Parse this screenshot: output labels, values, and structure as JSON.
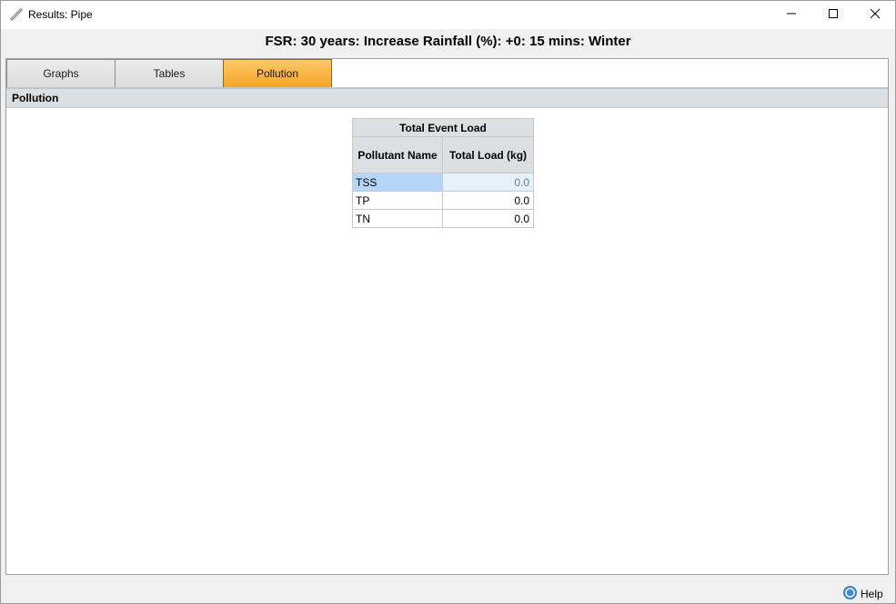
{
  "window": {
    "title": "Results: Pipe",
    "icon": "pipe-icon",
    "controls": [
      "minimize-icon",
      "maximize-icon",
      "close-icon"
    ]
  },
  "heading": "FSR: 30 years: Increase Rainfall (%): +0: 15 mins: Winter",
  "tabs": [
    {
      "label": "Graphs",
      "active": false
    },
    {
      "label": "Tables",
      "active": false
    },
    {
      "label": "Pollution",
      "active": true
    }
  ],
  "section": {
    "title": "Pollution"
  },
  "table": {
    "group_header": "Total Event Load",
    "columns": [
      "Pollutant Name",
      "Total Load (kg)"
    ],
    "rows": [
      {
        "name": "TSS",
        "load": "0.0",
        "selected": true
      },
      {
        "name": "TP",
        "load": "0.0",
        "selected": false
      },
      {
        "name": "TN",
        "load": "0.0",
        "selected": false
      }
    ]
  },
  "footer": {
    "help_label": "Help",
    "help_icon": "help-icon"
  },
  "colors": {
    "active_tab": "#f5a623",
    "selected_row": "#b6d6f7",
    "header_bg": "#dcdfe2"
  }
}
